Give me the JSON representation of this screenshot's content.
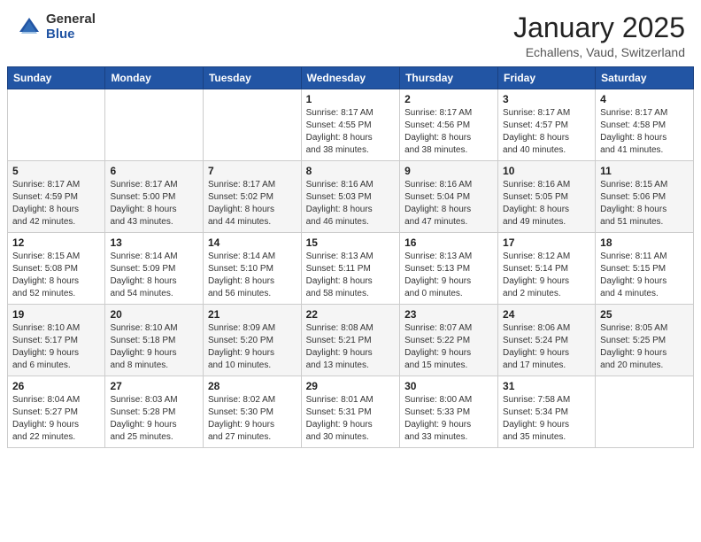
{
  "header": {
    "logo_general": "General",
    "logo_blue": "Blue",
    "month_title": "January 2025",
    "location": "Echallens, Vaud, Switzerland"
  },
  "weekdays": [
    "Sunday",
    "Monday",
    "Tuesday",
    "Wednesday",
    "Thursday",
    "Friday",
    "Saturday"
  ],
  "weeks": [
    [
      {
        "day": "",
        "info": ""
      },
      {
        "day": "",
        "info": ""
      },
      {
        "day": "",
        "info": ""
      },
      {
        "day": "1",
        "info": "Sunrise: 8:17 AM\nSunset: 4:55 PM\nDaylight: 8 hours\nand 38 minutes."
      },
      {
        "day": "2",
        "info": "Sunrise: 8:17 AM\nSunset: 4:56 PM\nDaylight: 8 hours\nand 38 minutes."
      },
      {
        "day": "3",
        "info": "Sunrise: 8:17 AM\nSunset: 4:57 PM\nDaylight: 8 hours\nand 40 minutes."
      },
      {
        "day": "4",
        "info": "Sunrise: 8:17 AM\nSunset: 4:58 PM\nDaylight: 8 hours\nand 41 minutes."
      }
    ],
    [
      {
        "day": "5",
        "info": "Sunrise: 8:17 AM\nSunset: 4:59 PM\nDaylight: 8 hours\nand 42 minutes."
      },
      {
        "day": "6",
        "info": "Sunrise: 8:17 AM\nSunset: 5:00 PM\nDaylight: 8 hours\nand 43 minutes."
      },
      {
        "day": "7",
        "info": "Sunrise: 8:17 AM\nSunset: 5:02 PM\nDaylight: 8 hours\nand 44 minutes."
      },
      {
        "day": "8",
        "info": "Sunrise: 8:16 AM\nSunset: 5:03 PM\nDaylight: 8 hours\nand 46 minutes."
      },
      {
        "day": "9",
        "info": "Sunrise: 8:16 AM\nSunset: 5:04 PM\nDaylight: 8 hours\nand 47 minutes."
      },
      {
        "day": "10",
        "info": "Sunrise: 8:16 AM\nSunset: 5:05 PM\nDaylight: 8 hours\nand 49 minutes."
      },
      {
        "day": "11",
        "info": "Sunrise: 8:15 AM\nSunset: 5:06 PM\nDaylight: 8 hours\nand 51 minutes."
      }
    ],
    [
      {
        "day": "12",
        "info": "Sunrise: 8:15 AM\nSunset: 5:08 PM\nDaylight: 8 hours\nand 52 minutes."
      },
      {
        "day": "13",
        "info": "Sunrise: 8:14 AM\nSunset: 5:09 PM\nDaylight: 8 hours\nand 54 minutes."
      },
      {
        "day": "14",
        "info": "Sunrise: 8:14 AM\nSunset: 5:10 PM\nDaylight: 8 hours\nand 56 minutes."
      },
      {
        "day": "15",
        "info": "Sunrise: 8:13 AM\nSunset: 5:11 PM\nDaylight: 8 hours\nand 58 minutes."
      },
      {
        "day": "16",
        "info": "Sunrise: 8:13 AM\nSunset: 5:13 PM\nDaylight: 9 hours\nand 0 minutes."
      },
      {
        "day": "17",
        "info": "Sunrise: 8:12 AM\nSunset: 5:14 PM\nDaylight: 9 hours\nand 2 minutes."
      },
      {
        "day": "18",
        "info": "Sunrise: 8:11 AM\nSunset: 5:15 PM\nDaylight: 9 hours\nand 4 minutes."
      }
    ],
    [
      {
        "day": "19",
        "info": "Sunrise: 8:10 AM\nSunset: 5:17 PM\nDaylight: 9 hours\nand 6 minutes."
      },
      {
        "day": "20",
        "info": "Sunrise: 8:10 AM\nSunset: 5:18 PM\nDaylight: 9 hours\nand 8 minutes."
      },
      {
        "day": "21",
        "info": "Sunrise: 8:09 AM\nSunset: 5:20 PM\nDaylight: 9 hours\nand 10 minutes."
      },
      {
        "day": "22",
        "info": "Sunrise: 8:08 AM\nSunset: 5:21 PM\nDaylight: 9 hours\nand 13 minutes."
      },
      {
        "day": "23",
        "info": "Sunrise: 8:07 AM\nSunset: 5:22 PM\nDaylight: 9 hours\nand 15 minutes."
      },
      {
        "day": "24",
        "info": "Sunrise: 8:06 AM\nSunset: 5:24 PM\nDaylight: 9 hours\nand 17 minutes."
      },
      {
        "day": "25",
        "info": "Sunrise: 8:05 AM\nSunset: 5:25 PM\nDaylight: 9 hours\nand 20 minutes."
      }
    ],
    [
      {
        "day": "26",
        "info": "Sunrise: 8:04 AM\nSunset: 5:27 PM\nDaylight: 9 hours\nand 22 minutes."
      },
      {
        "day": "27",
        "info": "Sunrise: 8:03 AM\nSunset: 5:28 PM\nDaylight: 9 hours\nand 25 minutes."
      },
      {
        "day": "28",
        "info": "Sunrise: 8:02 AM\nSunset: 5:30 PM\nDaylight: 9 hours\nand 27 minutes."
      },
      {
        "day": "29",
        "info": "Sunrise: 8:01 AM\nSunset: 5:31 PM\nDaylight: 9 hours\nand 30 minutes."
      },
      {
        "day": "30",
        "info": "Sunrise: 8:00 AM\nSunset: 5:33 PM\nDaylight: 9 hours\nand 33 minutes."
      },
      {
        "day": "31",
        "info": "Sunrise: 7:58 AM\nSunset: 5:34 PM\nDaylight: 9 hours\nand 35 minutes."
      },
      {
        "day": "",
        "info": ""
      }
    ]
  ]
}
